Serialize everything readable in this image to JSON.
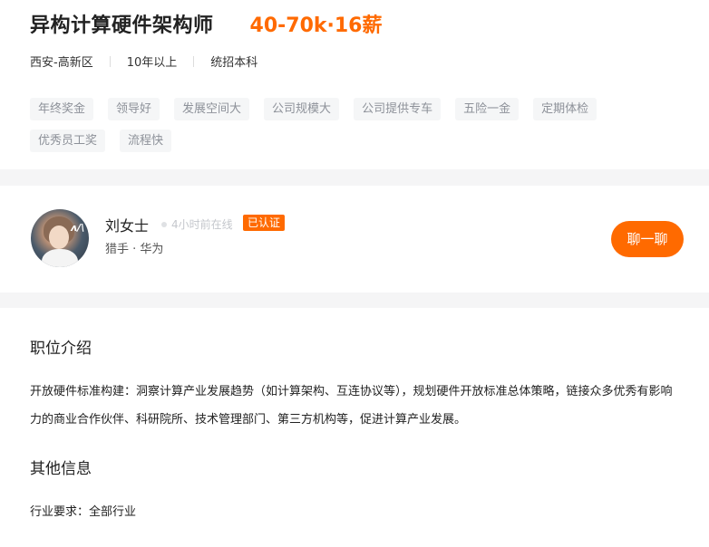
{
  "job": {
    "title": "异构计算硬件架构师",
    "salary": "40-70k·16薪",
    "location": "西安-高新区",
    "experience": "10年以上",
    "education": "统招本科",
    "benefits": [
      "年终奖金",
      "领导好",
      "发展空间大",
      "公司规模大",
      "公司提供专车",
      "五险一金",
      "定期体检",
      "优秀员工奖",
      "流程快"
    ]
  },
  "recruiter": {
    "name": "刘女士",
    "online_status": "4小时前在线",
    "badge": "已认证",
    "company_line": "猎手 · 华为",
    "avatar_logo_text": "ʌ/\\"
  },
  "chat_button": {
    "label": "聊一聊"
  },
  "description": {
    "section_title": "职位介绍",
    "text": "开放硬件标准构建：洞察计算产业发展趋势（如计算架构、互连协议等），规划硬件开放标准总体策略，链接众多优秀有影响力的商业合作伙伴、科研院所、技术管理部门、第三方机构等，促进计算产业发展。"
  },
  "other_info": {
    "section_title": "其他信息",
    "industry_label": "行业要求：",
    "industry_value": "全部行业"
  },
  "colors": {
    "accent": "#ff6a00",
    "tag_bg": "#f5f6f7",
    "tag_text": "#8d9199"
  }
}
